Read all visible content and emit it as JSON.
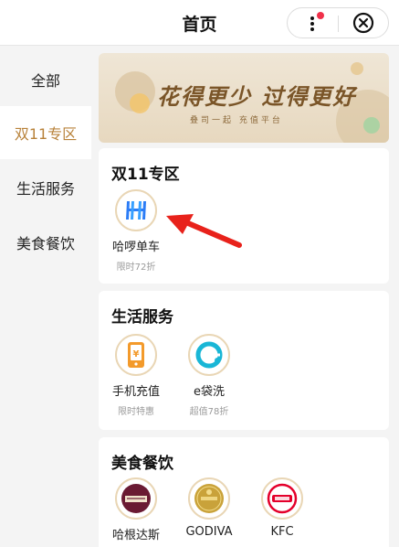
{
  "header": {
    "title": "首页",
    "more_icon": "more-dots-icon",
    "close_icon": "circle-close-icon"
  },
  "sidebar": {
    "items": [
      {
        "label": "全部",
        "active": false
      },
      {
        "label": "双11专区",
        "active": true
      },
      {
        "label": "生活服务",
        "active": false
      },
      {
        "label": "美食餐饮",
        "active": false
      }
    ]
  },
  "banner": {
    "slogan": "花得更少 过得更好",
    "subtitle": "叠司一起 充值平台"
  },
  "sections": [
    {
      "title": "双11专区",
      "items": [
        {
          "name": "哈啰单车",
          "promo": "限时72折",
          "icon": "hellobike-logo-icon"
        }
      ]
    },
    {
      "title": "生活服务",
      "items": [
        {
          "name": "手机充值",
          "promo": "限时特惠",
          "icon": "phone-recharge-icon"
        },
        {
          "name": "e袋洗",
          "promo": "超值78折",
          "icon": "e-laundry-icon"
        }
      ]
    },
    {
      "title": "美食餐饮",
      "items": [
        {
          "name": "哈根达斯",
          "promo": "",
          "icon": "haagen-dazs-logo-icon"
        },
        {
          "name": "GODIVA",
          "promo": "",
          "icon": "godiva-logo-icon"
        },
        {
          "name": "KFC",
          "promo": "",
          "icon": "kfc-logo-icon"
        }
      ]
    }
  ],
  "colors": {
    "accent_gold": "#b8823a",
    "arrow_red": "#e8221b",
    "badge_red": "#f0304a"
  }
}
